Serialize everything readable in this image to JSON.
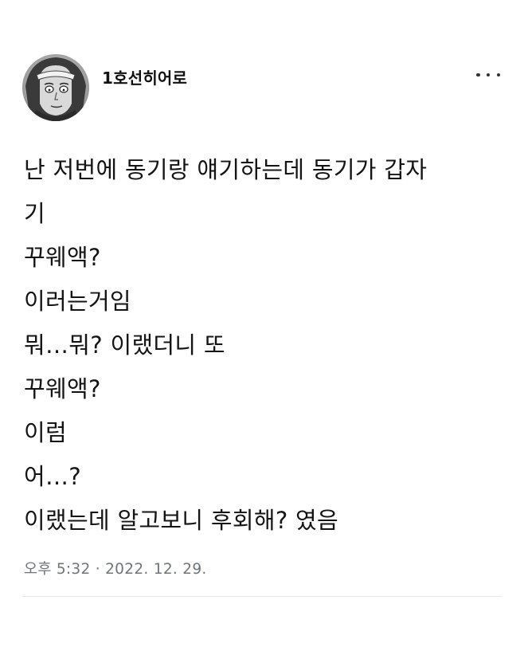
{
  "header": {
    "username": "1호선히어로",
    "avatar_icon": "profile-avatar-icon",
    "more_icon": "more-horizontal-icon"
  },
  "tweet": {
    "lines": [
      "난 저번에 동기랑 얘기하는데 동기가 갑자",
      "기",
      "꾸웨액?",
      "이러는거임",
      "뭐…뭐? 이랬더니 또",
      "꾸웨액?",
      "이럼",
      "어…?",
      "이랬는데 알고보니 후회해? 였음"
    ],
    "timestamp": "오후 5:32 · 2022. 12. 29."
  },
  "colors": {
    "text": "#141414",
    "muted": "#6e7479",
    "divider": "#e6e8ea"
  }
}
